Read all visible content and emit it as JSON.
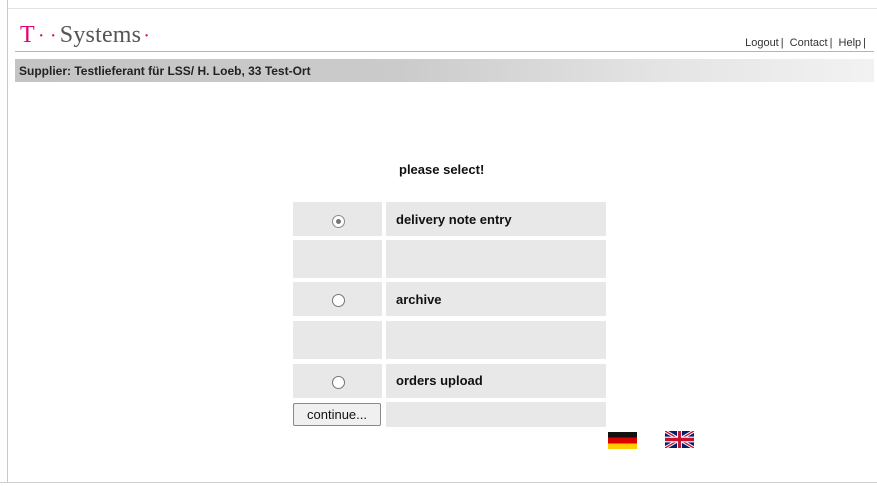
{
  "brand": {
    "logo_t": "T",
    "logo_dots": "· ·",
    "logo_name": "Systems",
    "logo_end_dot": "·",
    "colors": {
      "magenta": "#e20074"
    }
  },
  "top_links": {
    "logout": "Logout",
    "contact": "Contact",
    "help": "Help",
    "separator": "|"
  },
  "supplier_bar": {
    "text": "Supplier: Testlieferant für LSS/ H. Loeb, 33 Test-Ort"
  },
  "selection": {
    "prompt": "please select!",
    "selected_option": "delivery note entry",
    "options": [
      {
        "label": "delivery note entry",
        "checked": true
      },
      {
        "label": "archive",
        "checked": false
      },
      {
        "label": "orders upload",
        "checked": false
      }
    ]
  },
  "actions": {
    "continue_label": "continue..."
  },
  "languages": [
    {
      "name": "german-flag-icon",
      "lang": "de"
    },
    {
      "name": "uk-flag-icon",
      "lang": "en"
    }
  ]
}
